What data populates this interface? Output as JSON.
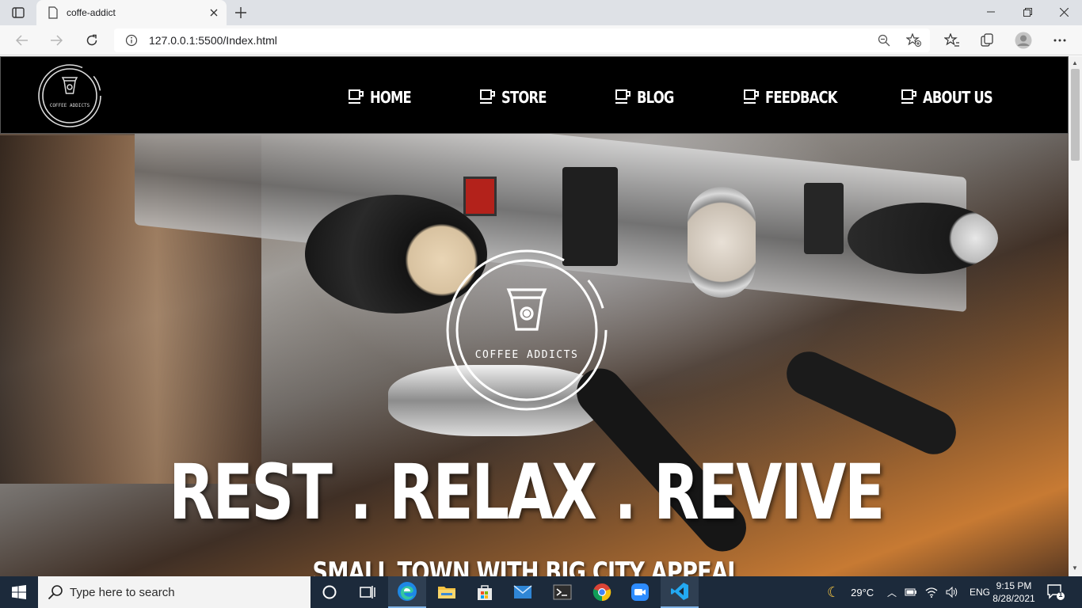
{
  "browser": {
    "tab_title": "coffe-addict",
    "url": "127.0.0.1:5500/Index.html"
  },
  "site": {
    "logo_text": "COFFEE ADDICTS",
    "nav": [
      {
        "label": "HOME"
      },
      {
        "label": "STORE"
      },
      {
        "label": "BLOG"
      },
      {
        "label": "FEEDBACK"
      },
      {
        "label": "ABOUT US"
      }
    ],
    "hero_logo_text": "COFFEE ADDICTS",
    "headline": "REST . RELAX . REVIVE",
    "subheadline": "SMALL TOWN WITH BIG CITY APPEAL"
  },
  "taskbar": {
    "search_placeholder": "Type here to search",
    "weather": "29°C",
    "language": "ENG",
    "time": "9:15 PM",
    "date": "8/28/2021",
    "notification_count": "1"
  },
  "colors": {
    "nav_bg": "#000000",
    "taskbar_bg": "#1c2a3b",
    "chrome_bg": "#dee1e6"
  }
}
